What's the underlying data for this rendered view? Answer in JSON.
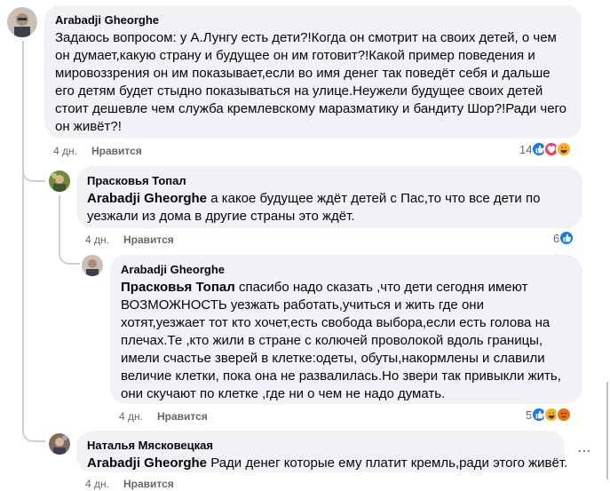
{
  "comments": [
    {
      "author": "Arabadji Gheorghe",
      "text": "Задаюсь вопросом: у А.Лунгу есть дети?!Когда он смотрит на своих детей, о чем он думает,какую страну и будущее он им готовит?!Какой пример поведения и мировоззрения он им показывает,если во имя денег так поведёт себя и дальше его детям будет стыдно показываться на улице.Неужели будущее своих детей стоит дешевле чем служба кремлевскому маразматику и бандиту Шор?!Ради чего он живёт?!",
      "time": "4 дн.",
      "like_label": "Нравится",
      "reaction_count": "14",
      "reactions": [
        "like-icon",
        "love-icon",
        "haha-icon"
      ]
    },
    {
      "author": "Прасковья Топал",
      "mention": "Arabadji Gheorghe",
      "text": " а какое будущее ждёт детей с Пас,то что все дети по уезжали из дома в другие страны это ждёт.",
      "time": "4 дн.",
      "like_label": "Нравится",
      "reaction_count": "6",
      "reactions": [
        "like-icon"
      ]
    },
    {
      "author": "Arabadji Gheorghe",
      "mention": "Прасковья Топал",
      "text": " спасибо надо сказать ,что дети сегодня имеют ВОЗМОЖНОСТЬ уезжать работать,учиться и жить где они хотят,уезжает тот кто хочет,есть свобода выбора,если есть голова на плечах.Те ,кто жили в стране с колючей проволокой вдоль границы, имели счастье зверей в клетке:одеты, обуты,накормлены и славили величие клетки, пока она не развалилась.Но звери так привыкли жить, они скучают по клетке ,где ни о чем не надо думать.",
      "time": "4 дн.",
      "like_label": "Нравится",
      "reaction_count": "5",
      "reactions": [
        "like-icon",
        "haha-icon",
        "angry-icon"
      ]
    },
    {
      "author": "Наталья Мясковецкая",
      "mention": "Arabadji Gheorghe",
      "text": " Ради денег которые ему платит кремль,ради этого живёт.",
      "time": "4 дн.",
      "like_label": "Нравится",
      "more_icon": "more-dots-icon"
    }
  ],
  "colors": {
    "bubble": "#f0f2f5",
    "secondary_text": "#65676b",
    "like_blue": "#1877f2",
    "love_red": "#f33e58",
    "haha_yellow": "#f7b125",
    "angry_orange": "#e9710f"
  }
}
